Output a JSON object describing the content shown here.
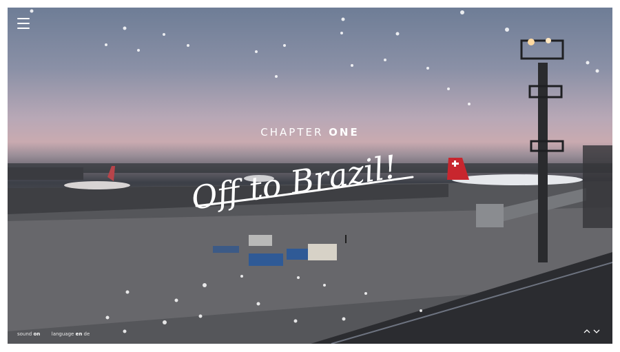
{
  "hero": {
    "kicker_prefix": "CHAPTER",
    "kicker_strong": "ONE",
    "headline": "Off to Brazil!",
    "image_icon": "airport-apron-photo"
  },
  "menu": {
    "icon": "hamburger-menu-icon"
  },
  "settings": {
    "sound_label": "sound",
    "sound_value": "on",
    "language_label": "language",
    "language_options": [
      "en",
      "de"
    ],
    "language_selected": "en"
  },
  "navigation": {
    "prev_icon": "chevron-up-icon",
    "next_icon": "chevron-down-icon"
  },
  "colors": {
    "text": "#ffffff",
    "background": "#ffffff"
  }
}
